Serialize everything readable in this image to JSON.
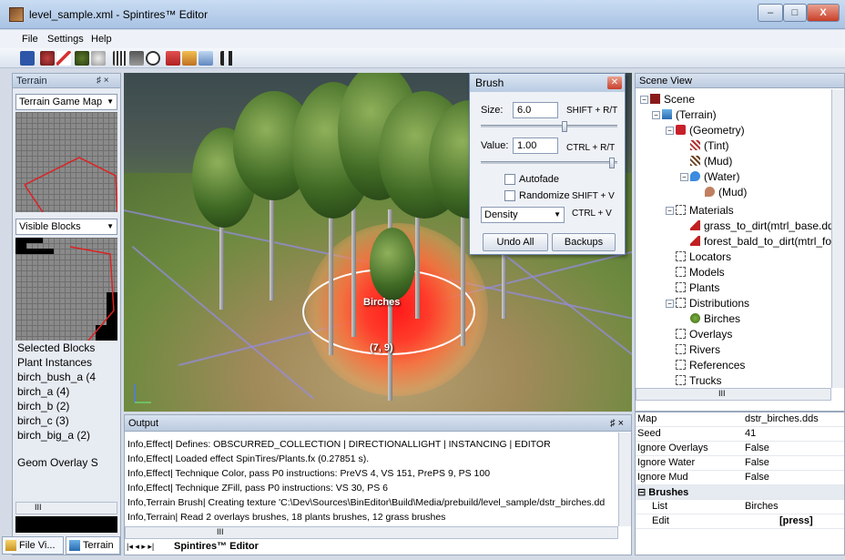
{
  "window": {
    "title": "level_sample.xml - Spintires™ Editor",
    "min": "–",
    "max": "□",
    "close": "X"
  },
  "menu": [
    "File",
    "Settings",
    "Help"
  ],
  "left_panel": {
    "header": "Terrain",
    "pin": "♯ ×",
    "map_combo": "Terrain Game Map",
    "blocks_combo": "Visible Blocks",
    "list": [
      "Selected Blocks",
      "Plant Instances",
      "birch_bush_a (4",
      "birch_a (4)",
      "birch_b (2)",
      "birch_c (3)",
      "birch_big_a (2)"
    ],
    "geom": "Geom Overlay S",
    "scroll_thumb": "III",
    "tabs": [
      {
        "label": "File Vi..."
      },
      {
        "label": "Terrain"
      }
    ]
  },
  "viewport": {
    "distribution_label": "Birches",
    "coords_label": "(7, 9)"
  },
  "brush": {
    "title": "Brush",
    "size_label": "Size:",
    "size_value": "6.0",
    "size_key": "SHIFT + R/T",
    "value_label": "Value:",
    "value_value": "1.00",
    "value_key": "CTRL + R/T",
    "autofade": "Autofade",
    "randomize": "Randomize",
    "randomize_key": "SHIFT + V",
    "mode": "Density",
    "mode_key": "CTRL + V",
    "undo_all": "Undo All",
    "backups": "Backups",
    "size_fraction": 0.62,
    "value_fraction": 0.98
  },
  "scene": {
    "header": "Scene View",
    "nodes": [
      {
        "label": "Scene",
        "icon": "scene-icon"
      },
      {
        "label": "(Terrain)",
        "icon": "terrain-icon"
      },
      {
        "label": "(Geometry)",
        "icon": "geometry-icon"
      },
      {
        "label": "(Tint)",
        "icon": "tint-icon"
      },
      {
        "label": "(Mud)",
        "icon": "mud-icon"
      },
      {
        "label": "(Water)",
        "icon": "water-icon"
      },
      {
        "label": "(Mud)",
        "icon": "water-mud-icon"
      },
      {
        "label": "Materials",
        "icon": "folder-icon"
      },
      {
        "label": "grass_to_dirt(mtrl_base.dds",
        "icon": "material-icon"
      },
      {
        "label": "forest_bald_to_dirt(mtrl_for",
        "icon": "material-icon"
      },
      {
        "label": "Locators",
        "icon": "folder-icon"
      },
      {
        "label": "Models",
        "icon": "folder-icon"
      },
      {
        "label": "Plants",
        "icon": "folder-icon"
      },
      {
        "label": "Distributions",
        "icon": "folder-icon"
      },
      {
        "label": "Birches",
        "icon": "plant-icon"
      },
      {
        "label": "Overlays",
        "icon": "folder-icon"
      },
      {
        "label": "Rivers",
        "icon": "folder-icon"
      },
      {
        "label": "References",
        "icon": "folder-icon"
      },
      {
        "label": "Trucks",
        "icon": "folder-icon"
      }
    ],
    "hscroll": "III"
  },
  "properties": [
    {
      "key": "Map",
      "value": "dstr_birches.dds"
    },
    {
      "key": "Seed",
      "value": "41"
    },
    {
      "key": "Ignore Overlays",
      "value": "False"
    },
    {
      "key": "Ignore Water",
      "value": "False"
    },
    {
      "key": "Ignore Mud",
      "value": "False"
    },
    {
      "key": "⊟ Brushes",
      "value": ""
    },
    {
      "key": "List",
      "value": "Birches"
    },
    {
      "key": "Edit",
      "value": "[press]"
    }
  ],
  "output": {
    "header": "Output",
    "pin": "♯ ×",
    "lines": [
      "Info,Effect| Defines: OBSCURRED_COLLECTION | DIRECTIONALLIGHT | INSTANCING | EDITOR",
      "Info,Effect| Loaded effect SpinTires/Plants.fx (0.27851 s).",
      "Info,Effect| Technique Color, pass P0 instructions: PreVS 4, VS 151, PrePS 9, PS 100",
      "Info,Effect| Technique ZFill, pass P0 instructions: VS 30, PS 6",
      "Info,Terrain Brush| Creating texture 'C:\\Dev\\Sources\\BinEditor\\Build\\Media/prebuild/level_sample/dstr_birches.dd",
      "Info,Terrain| Read 2 overlays brushes, 18 plants brushes, 12 grass brushes"
    ],
    "scroll_thumb": "III",
    "doc_nav": "|◂ ◂ ▸ ▸|",
    "doc_tab": "Spintires™ Editor"
  }
}
